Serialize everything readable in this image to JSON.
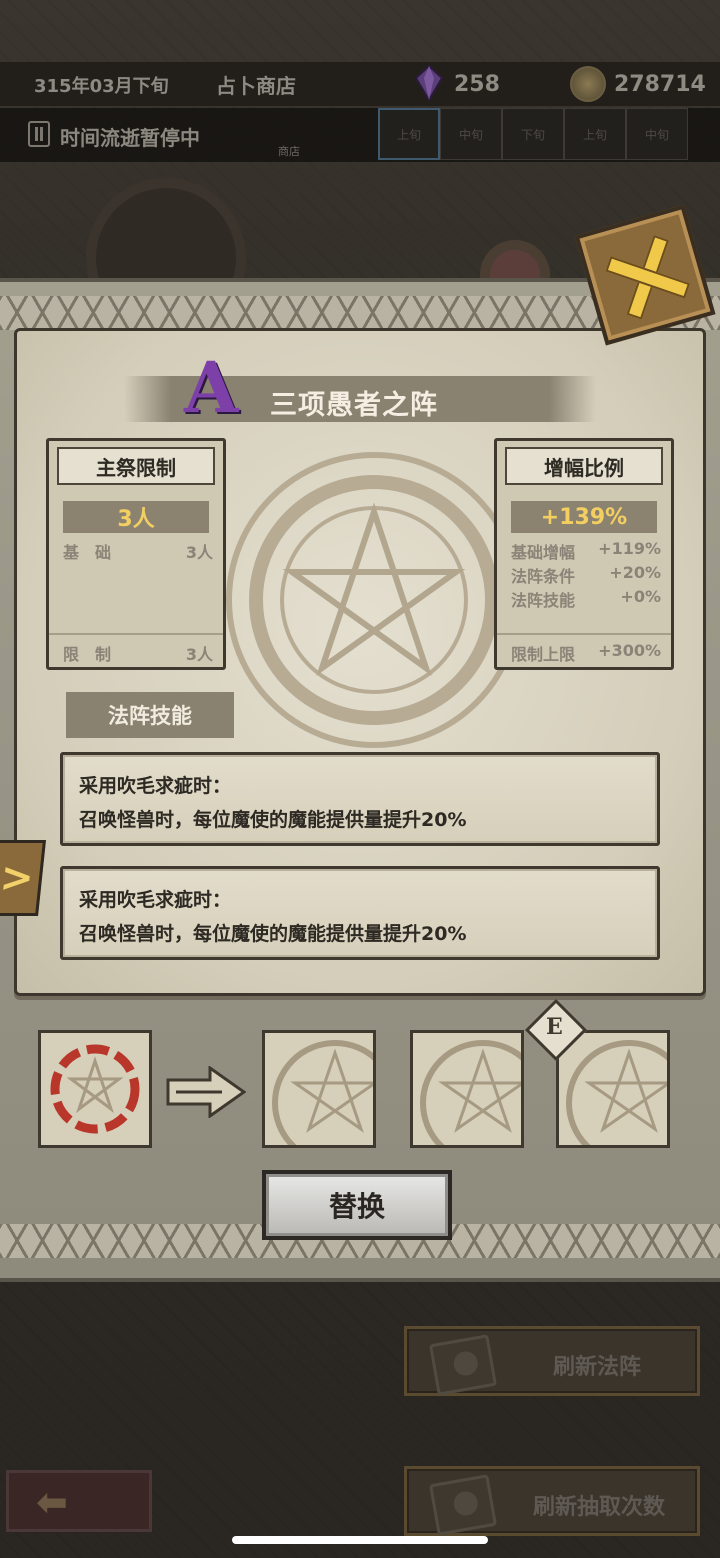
{
  "status": {
    "date": "315年03月下旬",
    "location": "占卜商店",
    "gems": "258",
    "coins": "278714"
  },
  "pause": {
    "text": "时间流逝暂停中",
    "shop_tab": "商店"
  },
  "xun_tabs": [
    "上旬",
    "中旬",
    "下旬",
    "上旬",
    "中旬"
  ],
  "array": {
    "grade": "A",
    "name": "三项愚者之阵"
  },
  "priest_panel": {
    "title": "主祭限制",
    "value": "3人",
    "rows": [
      {
        "label": "基　础",
        "value": "3人"
      }
    ],
    "footer": {
      "label": "限　制",
      "value": "3人"
    }
  },
  "boost_panel": {
    "title": "增幅比例",
    "value": "+139%",
    "rows": [
      {
        "label": "基础增幅",
        "value": "+119%"
      },
      {
        "label": "法阵条件",
        "value": "+20%"
      },
      {
        "label": "法阵技能",
        "value": "+0%"
      }
    ],
    "footer": {
      "label": "限制上限",
      "value": "+300%"
    }
  },
  "skills": {
    "tab_label": "法阵技能",
    "items": [
      {
        "line1": "采用吹毛求疵时：",
        "line2": "召唤怪兽时，每位魔使的魔能提供量提升20%"
      },
      {
        "line1": "采用吹毛求疵时：",
        "line2": "召唤怪兽时，每位魔使的魔能提供量提升20%"
      }
    ]
  },
  "slot_badge": "E",
  "buttons": {
    "replace": "替换",
    "refresh_array": "刷新法阵",
    "refresh_draws": "刷新抽取次数"
  },
  "colors": {
    "grade_purple": "#7d3fa8",
    "highlight_gold": "#f3cf62",
    "parchment": "#d6cfba",
    "seal_red": "#b8362a"
  }
}
